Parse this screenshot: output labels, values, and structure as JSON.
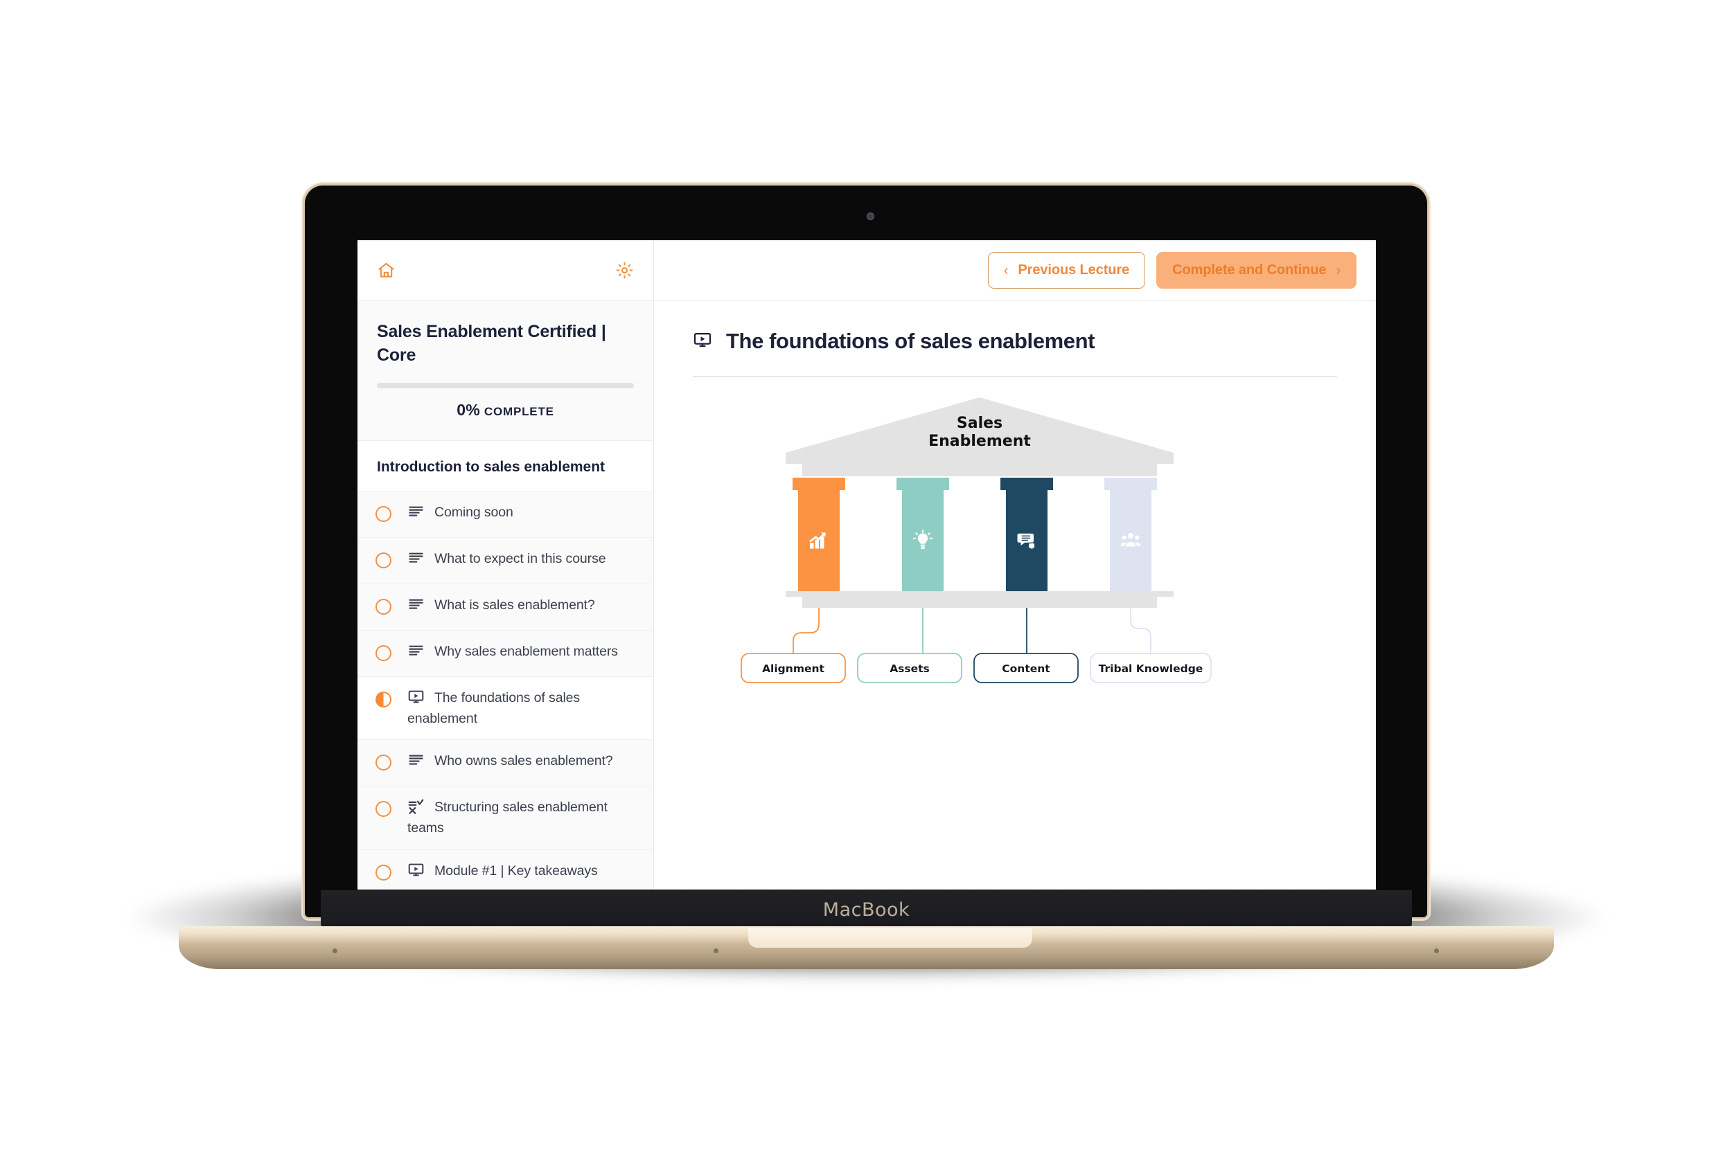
{
  "device": {
    "brand": "MacBook"
  },
  "sidebar": {
    "toolbar": {
      "home_icon": "home-icon",
      "settings_icon": "gear-icon",
      "accent": "#f2913f"
    },
    "course": {
      "title": "Sales Enablement Certified | Core",
      "progress_percent": "0%",
      "progress_word": "COMPLETE",
      "progress_value": 0
    },
    "section_title": "Introduction to sales enablement",
    "lessons": [
      {
        "label": "Coming soon",
        "icon": "text-lines-icon",
        "status": "not-started"
      },
      {
        "label": "What to expect in this course",
        "icon": "text-lines-icon",
        "status": "not-started"
      },
      {
        "label": "What is sales enablement?",
        "icon": "text-lines-icon",
        "status": "not-started"
      },
      {
        "label": "Why sales enablement matters",
        "icon": "text-lines-icon",
        "status": "not-started"
      },
      {
        "label": "The foundations of sales enablement",
        "icon": "video-icon",
        "status": "in-progress"
      },
      {
        "label": "Who owns sales enablement?",
        "icon": "text-lines-icon",
        "status": "not-started"
      },
      {
        "label": "Structuring sales enablement teams",
        "icon": "quiz-icon",
        "status": "not-started"
      },
      {
        "label": "Module #1 | Key takeaways",
        "icon": "video-icon",
        "status": "not-started"
      }
    ]
  },
  "topbar": {
    "previous_label": "Previous Lecture",
    "next_label": "Complete and Continue",
    "prev_chevron": "‹",
    "next_chevron": "›"
  },
  "lesson": {
    "icon": "video-icon",
    "heading": "The foundations of sales enablement"
  },
  "diagram": {
    "roof_title_line1": "Sales",
    "roof_title_line2": "Enablement",
    "pillars": [
      {
        "label": "Alignment",
        "icon": "growth-chart-icon",
        "color": "#fb9342"
      },
      {
        "label": "Assets",
        "icon": "lightbulb-icon",
        "color": "#8dcdc3"
      },
      {
        "label": "Content",
        "icon": "chat-bubbles-icon",
        "color": "#1f4862"
      },
      {
        "label": "Tribal Knowledge",
        "icon": "people-group-icon",
        "color": "#dde3f1"
      }
    ]
  }
}
